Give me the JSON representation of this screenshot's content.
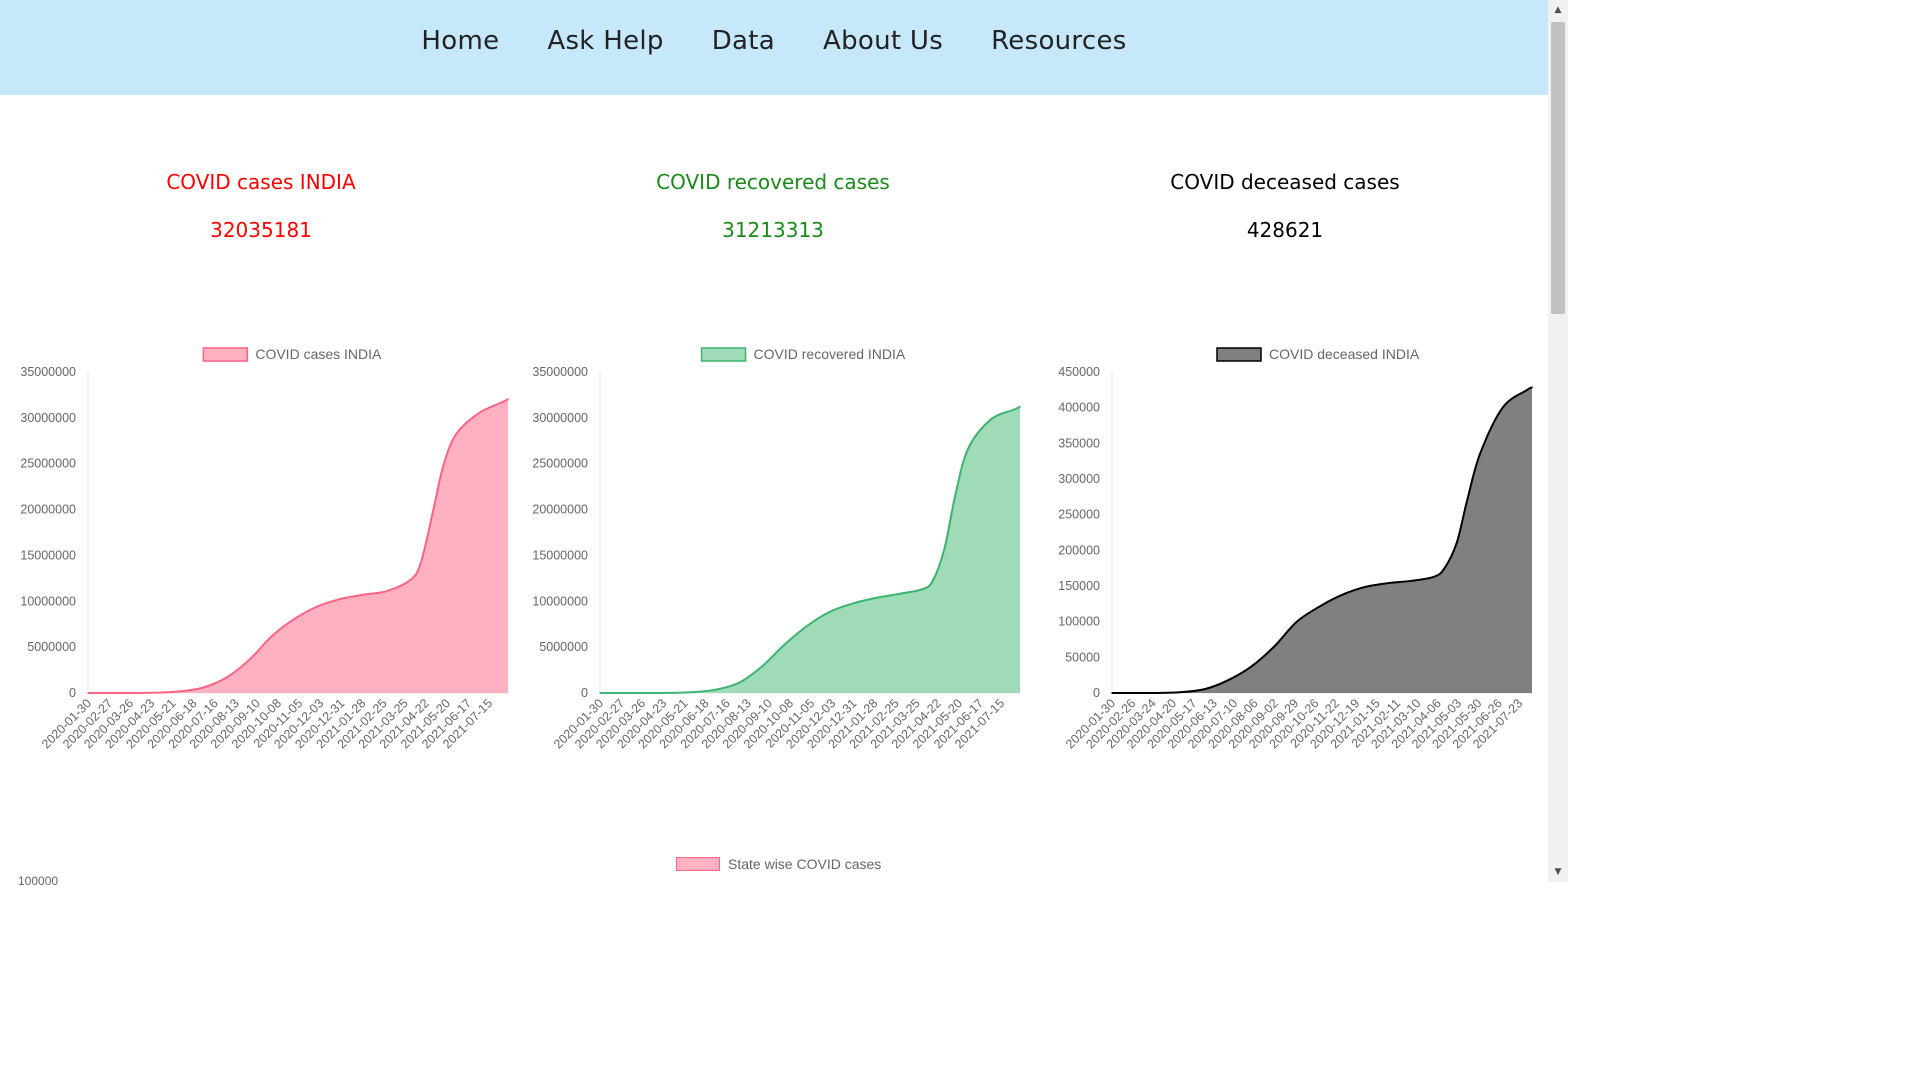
{
  "nav": {
    "home": "Home",
    "ask_help": "Ask Help",
    "data": "Data",
    "about_us": "About Us",
    "resources": "Resources"
  },
  "stats": {
    "cases": {
      "title": "COVID cases INDIA",
      "value": "32035181",
      "color": "#ff0000"
    },
    "recovered": {
      "title": "COVID recovered cases",
      "value": "31213313",
      "color": "#1a8a1a"
    },
    "deceased": {
      "title": "COVID deceased cases",
      "value": "428621",
      "color": "#000000"
    }
  },
  "chart_data": [
    {
      "type": "area",
      "legend": "COVID cases INDIA",
      "color": "#ff6384",
      "fill": "#ffb1c1",
      "ylim": [
        0,
        35000000
      ],
      "yticks": [
        0,
        5000000,
        10000000,
        15000000,
        20000000,
        25000000,
        30000000,
        35000000
      ],
      "x_tick_labels": [
        "2020-01-30",
        "2020-02-27",
        "2020-03-26",
        "2020-04-23",
        "2020-05-21",
        "2020-06-18",
        "2020-07-16",
        "2020-08-13",
        "2020-09-10",
        "2020-10-08",
        "2020-11-05",
        "2020-12-03",
        "2020-12-31",
        "2021-01-28",
        "2021-02-25",
        "2021-03-25",
        "2021-04-22",
        "2021-05-20",
        "2021-06-17",
        "2021-07-15"
      ],
      "x": [
        "2020-01-30",
        "2020-03-01",
        "2020-04-01",
        "2020-05-01",
        "2020-06-01",
        "2020-07-01",
        "2020-08-01",
        "2020-09-01",
        "2020-10-01",
        "2020-11-01",
        "2020-12-01",
        "2021-01-01",
        "2021-02-01",
        "2021-03-01",
        "2021-04-01",
        "2021-04-15",
        "2021-05-01",
        "2021-05-15",
        "2021-06-01",
        "2021-07-01",
        "2021-08-01",
        "2021-08-09"
      ],
      "values": [
        1,
        3,
        1500,
        35000,
        190000,
        600000,
        1700000,
        3700000,
        6300000,
        8200000,
        9500000,
        10300000,
        10750000,
        11100000,
        12300000,
        14100000,
        19600000,
        24700000,
        28200000,
        30500000,
        31700000,
        32035181
      ]
    },
    {
      "type": "area",
      "legend": "COVID recovered INDIA",
      "color": "#3cb371",
      "fill": "#9fdbb6",
      "ylim": [
        0,
        35000000
      ],
      "yticks": [
        0,
        5000000,
        10000000,
        15000000,
        20000000,
        25000000,
        30000000,
        35000000
      ],
      "x_tick_labels": [
        "2020-01-30",
        "2020-02-27",
        "2020-03-26",
        "2020-04-23",
        "2020-05-21",
        "2020-06-18",
        "2020-07-16",
        "2020-08-13",
        "2020-09-10",
        "2020-10-08",
        "2020-11-05",
        "2020-12-03",
        "2020-12-31",
        "2021-01-28",
        "2021-02-25",
        "2021-03-25",
        "2021-04-22",
        "2021-05-20",
        "2021-06-17",
        "2021-07-15"
      ],
      "x": [
        "2020-01-30",
        "2020-03-01",
        "2020-04-01",
        "2020-05-01",
        "2020-06-01",
        "2020-07-01",
        "2020-08-01",
        "2020-09-01",
        "2020-10-01",
        "2020-11-01",
        "2020-12-01",
        "2021-01-01",
        "2021-02-01",
        "2021-03-01",
        "2021-04-01",
        "2021-04-15",
        "2021-05-01",
        "2021-05-15",
        "2021-06-01",
        "2021-07-01",
        "2021-08-01",
        "2021-08-09"
      ],
      "values": [
        0,
        3,
        150,
        9000,
        95000,
        360000,
        1100000,
        2900000,
        5300000,
        7400000,
        8900000,
        9800000,
        10400000,
        10800000,
        11300000,
        12200000,
        15800000,
        21500000,
        26600000,
        29800000,
        30900000,
        31213313
      ]
    },
    {
      "type": "area",
      "legend": "COVID deceased INDIA",
      "color": "#000000",
      "fill": "#808080",
      "ylim": [
        0,
        450000
      ],
      "yticks": [
        0,
        50000,
        100000,
        150000,
        200000,
        250000,
        300000,
        350000,
        400000,
        450000
      ],
      "x_tick_labels": [
        "2020-01-30",
        "2020-02-26",
        "2020-03-24",
        "2020-04-20",
        "2020-05-17",
        "2020-06-13",
        "2020-07-10",
        "2020-08-06",
        "2020-09-02",
        "2020-09-29",
        "2020-10-26",
        "2020-11-22",
        "2020-12-19",
        "2021-01-15",
        "2021-02-11",
        "2021-03-10",
        "2021-04-06",
        "2021-05-03",
        "2021-05-30",
        "2021-06-26",
        "2021-07-23"
      ],
      "x": [
        "2020-01-30",
        "2020-03-01",
        "2020-04-01",
        "2020-05-01",
        "2020-06-01",
        "2020-07-01",
        "2020-08-01",
        "2020-09-01",
        "2020-10-01",
        "2020-11-01",
        "2020-12-01",
        "2021-01-01",
        "2021-02-01",
        "2021-03-01",
        "2021-04-01",
        "2021-04-15",
        "2021-05-01",
        "2021-05-15",
        "2021-06-01",
        "2021-07-01",
        "2021-08-01",
        "2021-08-09"
      ],
      "values": [
        0,
        0,
        50,
        1200,
        5400,
        17400,
        36500,
        65000,
        99800,
        121700,
        138000,
        149000,
        154300,
        157100,
        162900,
        175000,
        210000,
        270000,
        335000,
        400000,
        424000,
        428621
      ]
    }
  ],
  "bottom_chart": {
    "legend": "State wise COVID cases",
    "first_tick": "100000"
  }
}
